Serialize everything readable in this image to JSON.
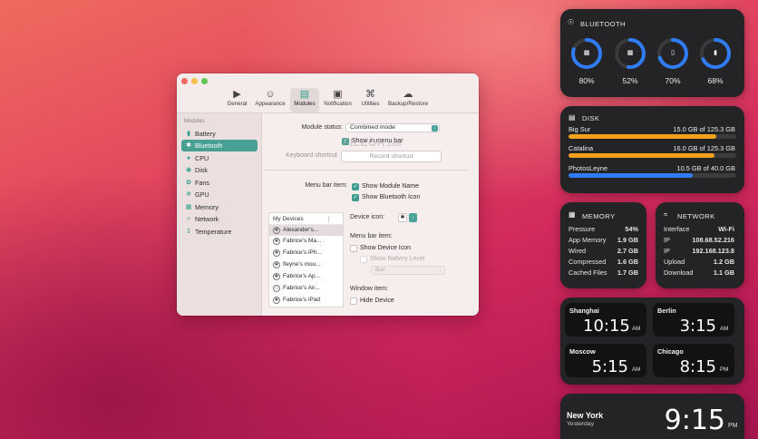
{
  "prefs": {
    "toolbar": [
      {
        "label": "General",
        "icon": "play-circle-icon"
      },
      {
        "label": "Appearance",
        "icon": "mask-icon"
      },
      {
        "label": "Modules",
        "icon": "modules-icon"
      },
      {
        "label": "Notification",
        "icon": "notification-icon"
      },
      {
        "label": "Utilities",
        "icon": "command-icon"
      },
      {
        "label": "Backup/Restore",
        "icon": "cloud-icon"
      }
    ],
    "sidebar_header": "Modules",
    "sidebar": [
      {
        "label": "Battery",
        "icon": "battery-icon"
      },
      {
        "label": "Bluetooth",
        "icon": "bluetooth-icon"
      },
      {
        "label": "CPU",
        "icon": "cpu-icon"
      },
      {
        "label": "Disk",
        "icon": "disk-icon"
      },
      {
        "label": "Fans",
        "icon": "fan-icon"
      },
      {
        "label": "GPU",
        "icon": "gpu-icon"
      },
      {
        "label": "Memory",
        "icon": "memory-icon"
      },
      {
        "label": "Network",
        "icon": "wifi-icon"
      },
      {
        "label": "Temperature",
        "icon": "thermometer-icon"
      }
    ],
    "module_status_label": "Module status:",
    "module_status_value": "Combined mode",
    "show_in_menu_bar": "Show in menu bar",
    "keyboard_shortcut_label": "Keyboard shortcut",
    "record_shortcut": "Record shortcut",
    "menu_bar_item_label": "Menu bar item:",
    "show_module_name": "Show Module Name",
    "show_bluetooth_icon": "Show Bluetooth Icon",
    "devices_header": "My Devices",
    "devices": [
      "Alexander's...",
      "Fabrice's Ma...",
      "Fabrice's iPh...",
      "fleyne's mou...",
      "Fabrice's Ap...",
      "Fabrice's Air...",
      "Fabrice's iPad"
    ],
    "device_icon_label": "Device icon:",
    "device_menu_bar_item": "Menu bar item:",
    "show_device_icon": "Show Device Icon",
    "show_battery_level": "Show Battery Level",
    "battery_style": "Bar",
    "window_item": "Window item:",
    "hide_device": "Hide Device"
  },
  "watermark": {
    "main": "FILEOR",
    "sub": ".com"
  },
  "bluetooth_widget": {
    "title": "BLUETOOTH",
    "devices": [
      {
        "value": "80%",
        "fraction": 0.8,
        "icon": "keyboard-icon"
      },
      {
        "value": "52%",
        "fraction": 0.52,
        "icon": "keyboard-icon"
      },
      {
        "value": "70%",
        "fraction": 0.7,
        "icon": "phone-icon"
      },
      {
        "value": "68%",
        "fraction": 0.68,
        "icon": "tablet-icon"
      }
    ]
  },
  "disk_widget": {
    "title": "DISK",
    "disks": [
      {
        "name": "Big Sur",
        "value": "15.0 GB of 125.3 GB",
        "fraction": 0.88,
        "color": "#f4a11c"
      },
      {
        "name": "Catalina",
        "value": "16.0 GB of 125.3 GB",
        "fraction": 0.87,
        "color": "#f4a11c"
      },
      {
        "name": "PhotosLeyne",
        "value": "10.5 GB of 40.0 GB",
        "fraction": 0.74,
        "color": "#2f7cf6"
      }
    ]
  },
  "memory_widget": {
    "title": "MEMORY",
    "rows": [
      {
        "k": "Pressure",
        "v": "54%"
      },
      {
        "k": "App Memory",
        "v": "1.9 GB"
      },
      {
        "k": "Wired",
        "v": "2.7 GB"
      },
      {
        "k": "Compressed",
        "v": "1.6 GB"
      },
      {
        "k": "Cached Files",
        "v": "1.7 GB"
      }
    ]
  },
  "network_widget": {
    "title": "NETWORK",
    "rows": [
      {
        "k": "Interface",
        "v": "Wi-Fi"
      },
      {
        "k": "IP",
        "v": "108.68.52.216"
      },
      {
        "k": "IP",
        "v": "192.168.123.8"
      },
      {
        "k": "Upload",
        "v": "1.2 GB"
      },
      {
        "k": "Download",
        "v": "1.1 GB"
      }
    ]
  },
  "world_clock": [
    {
      "city": "Shanghai",
      "time": "10:15",
      "ampm": "AM"
    },
    {
      "city": "Berlin",
      "time": "3:15",
      "ampm": "AM"
    },
    {
      "city": "Moscow",
      "time": "5:15",
      "ampm": "AM"
    },
    {
      "city": "Chicago",
      "time": "8:15",
      "ampm": "PM"
    }
  ],
  "big_clock": {
    "city": "New York",
    "day": "Yesterday",
    "time": "9:15",
    "ampm": "PM"
  },
  "colors": {
    "accent": "#48a095",
    "ring": "#2f7cf6",
    "disk_orange": "#f4a11c",
    "disk_blue": "#2f7cf6"
  }
}
